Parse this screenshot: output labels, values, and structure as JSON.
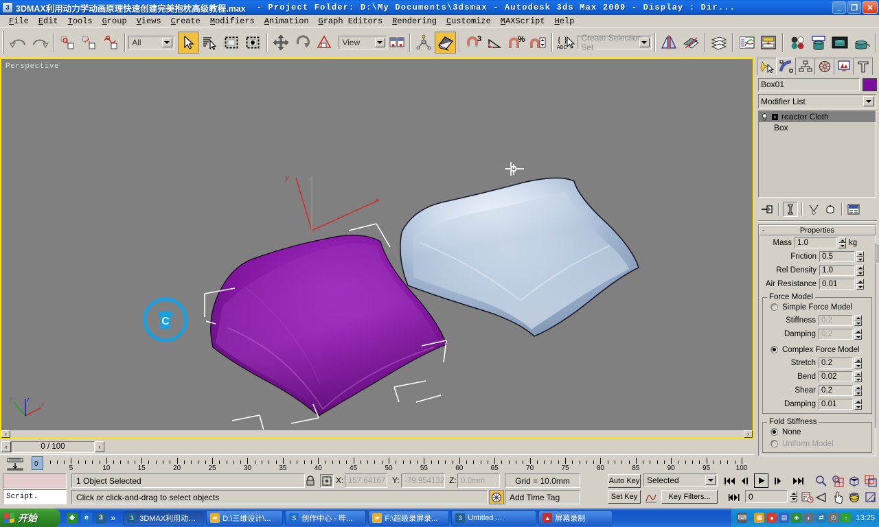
{
  "titlebar": {
    "icon": "max-app-icon",
    "doc_title": "3DMAX利用动力学动画原理快速创建完美抱枕高级教程.max",
    "rest": "- Project Folder: D:\\My Documents\\3dsmax      - Autodesk 3ds Max  2009      - Display : Dir...",
    "minimize": "_",
    "restore": "❐",
    "close": "✕"
  },
  "menu": {
    "items": [
      "File",
      "Edit",
      "Tools",
      "Group",
      "Views",
      "Create",
      "Modifiers",
      "Animation",
      "Graph Editors",
      "Rendering",
      "Customize",
      "MAXScript",
      "Help"
    ]
  },
  "toolbar": {
    "undo": "Undo",
    "redo": "Redo",
    "select_link": "Select and Link",
    "unlink": "Unlink Selection",
    "bind_space_warp": "Bind to Space Warp",
    "selection_filter_value": "All",
    "select_object": "Select Object",
    "select_by_name": "Select by Name",
    "select_region": "Rectangular Selection Region",
    "window_crossing": "Window/Crossing",
    "select_move": "Select and Move",
    "select_rotate": "Select and Rotate",
    "select_scale": "Select and Uniform Scale",
    "ref_coord_value": "View",
    "pivot_center": "Use Pivot Point Center",
    "mirror": "Mirror",
    "align": "Align",
    "snap_toggle": "Snaps Toggle 3",
    "angle_snap": "Angle Snap Toggle",
    "percent_snap": "Percent Snap Toggle",
    "spinner_snap": "Spinner Snap Toggle",
    "named_selection": "Edit Named Selection Sets",
    "selection_set_placeholder": "Create Selection Set",
    "layer_manager": "Layer Manager",
    "curve_editor": "Curve Editor",
    "schematic_view": "Schematic View",
    "material_editor": "Material Editor",
    "render_setup": "Render Setup",
    "rendered_frame": "Rendered Frame Window",
    "render_production": "Render Production"
  },
  "viewport": {
    "label": "Perspective",
    "cloth_helper_letter": "C",
    "axis_tripod": {
      "x": "x",
      "y": "y",
      "z": "z"
    },
    "gizmo": {
      "x": "x",
      "y": "y",
      "z": "z"
    },
    "pillow_front_color": "#8b1aa8",
    "pillow_back_color": "#b8cade",
    "background": "#808080",
    "scroll_left": "‹",
    "scroll_right": "›"
  },
  "command_panel": {
    "tabs": [
      "create-tab",
      "modify-tab",
      "hierarchy-tab",
      "motion-tab",
      "display-tab",
      "utilities-tab"
    ],
    "selected_tab_index": 1,
    "object_name": "Box01",
    "object_color": "#7a0f9e",
    "modifier_list_label": "Modifier List",
    "stack": [
      {
        "label": "reactor Cloth",
        "selected": true,
        "has_light_bulb": true,
        "expandable": true
      },
      {
        "label": "Box",
        "selected": false,
        "has_light_bulb": false,
        "expandable": false
      }
    ],
    "stack_tools": [
      "pin-stack-icon",
      "show-end-result-icon",
      "make-unique-icon",
      "remove-modifier-icon",
      "configure-modifier-sets-icon"
    ],
    "properties": {
      "title": "Properties",
      "collapse_sign": "-",
      "mass_label": "Mass",
      "mass_value": "1.0",
      "mass_unit": "kg",
      "friction_label": "Friction",
      "friction_value": "0.5",
      "rel_density_label": "Rel Density",
      "rel_density_value": "1.0",
      "air_resistance_label": "Air Resistance",
      "air_resistance_value": "0.01"
    },
    "force_model": {
      "title": "Force Model",
      "simple_label": "Simple Force Model",
      "simple_selected": false,
      "stiffness_label": "Stiffness",
      "stiffness_value": "0.2",
      "damping_simple_label": "Damping",
      "damping_simple_value": "0.2",
      "complex_label": "Complex Force Model",
      "complex_selected": true,
      "stretch_label": "Stretch",
      "stretch_value": "0.2",
      "bend_label": "Bend",
      "bend_value": "0.02",
      "shear_label": "Shear",
      "shear_value": "0.2",
      "damping_complex_label": "Damping",
      "damping_complex_value": "0.01"
    },
    "fold_stiffness": {
      "title": "Fold Stiffness",
      "none_label": "None",
      "none_selected": true,
      "uniform_label": "Uniform Model",
      "uniform_selected": false
    }
  },
  "timeline": {
    "prev_frame": "‹",
    "next_frame": "›",
    "frame_readout": "0 / 100",
    "slider_value": "0",
    "ticks": [
      "0",
      "5",
      "10",
      "15",
      "20",
      "25",
      "30",
      "35",
      "40",
      "45",
      "50",
      "55",
      "60",
      "65",
      "70",
      "75",
      "80",
      "85",
      "90",
      "95",
      "100"
    ]
  },
  "status": {
    "script_listener_label": "Script.",
    "selection_text": "1 Object Selected",
    "prompt_text": "Click or click-and-drag to select objects",
    "lock_icon": "lock-selection-icon",
    "abs_rel_icon": "absolute-relative-transform-icon",
    "x_label": "X:",
    "x_value": "157.64167",
    "y_label": "Y:",
    "y_value": "-79.954132",
    "z_label": "Z:",
    "z_value": "0.0mm",
    "grid_text": "Grid = 10.0mm",
    "add_time_tag": "Add Time Tag",
    "auto_key": "Auto Key",
    "set_key": "Set Key",
    "key_mode_value": "Selected",
    "key_filters": "Key Filters...",
    "current_frame": "0",
    "nav_icons": [
      "zoom-icon",
      "zoom-all-icon",
      "zoom-extents-icon",
      "zoom-region-icon",
      "field-of-view-icon",
      "pan-icon",
      "arc-rotate-icon",
      "maximize-viewport-icon"
    ],
    "playback_icons": [
      "go-to-start-icon",
      "previous-frame-icon",
      "play-animation-icon",
      "next-frame-icon",
      "go-to-end-icon",
      "key-mode-icon",
      "time-configuration-icon"
    ]
  },
  "taskbar": {
    "start_label": "开始",
    "quick_launch": [
      "shield-icon",
      "internet-explorer-icon",
      "max-icon"
    ],
    "overflow": "»",
    "tasks": [
      {
        "label": "3DMAX利用动力...",
        "icon": "max-icon",
        "active": true
      },
      {
        "label": "D:\\三维设计\\...",
        "icon": "folder-icon",
        "active": false
      },
      {
        "label": "创作中心 - 哔...",
        "icon": "browser-icon",
        "active": false
      },
      {
        "label": "F:\\超级录屏录...",
        "icon": "folder-icon",
        "active": false
      },
      {
        "label": "Untitled     ...",
        "icon": "max-icon",
        "active": false
      },
      {
        "label": "屏幕录制",
        "icon": "recorder-icon",
        "active": false
      }
    ],
    "tray_icons": [
      "keyboard-icon",
      "calendar-icon",
      "qq-icon",
      "network-icon",
      "shield-icon",
      "volume-icon",
      "sync-icon",
      "clock-icon",
      "update-icon"
    ],
    "clock": "13:25"
  }
}
